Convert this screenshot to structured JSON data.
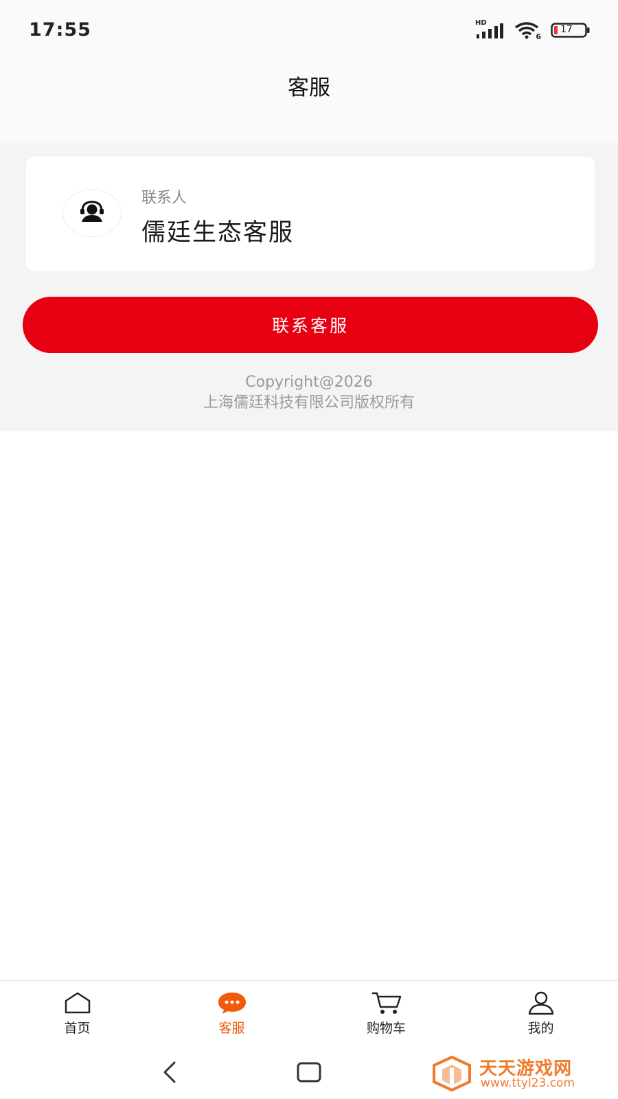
{
  "status_bar": {
    "time": "17:55",
    "signal_label": "HD",
    "wifi_label": "6",
    "battery_level": "17"
  },
  "header": {
    "title": "客服"
  },
  "contact": {
    "label": "联系人",
    "name": "儒廷生态客服",
    "avatar_icon": "customer-service-icon"
  },
  "contact_button": {
    "label": "联系客服",
    "color": "#e60012"
  },
  "footer": {
    "copyright_line1": "Copyright@2026",
    "copyright_line2": "上海儒廷科技有限公司版权所有"
  },
  "bottom_nav": {
    "active_color": "#f25a0b",
    "items": [
      {
        "label": "首页",
        "icon": "home-icon"
      },
      {
        "label": "客服",
        "icon": "chat-icon"
      },
      {
        "label": "购物车",
        "icon": "cart-icon"
      },
      {
        "label": "我的",
        "icon": "user-icon"
      }
    ]
  },
  "watermark": {
    "title": "天天游戏网",
    "url": "www.ttyl23.com"
  }
}
